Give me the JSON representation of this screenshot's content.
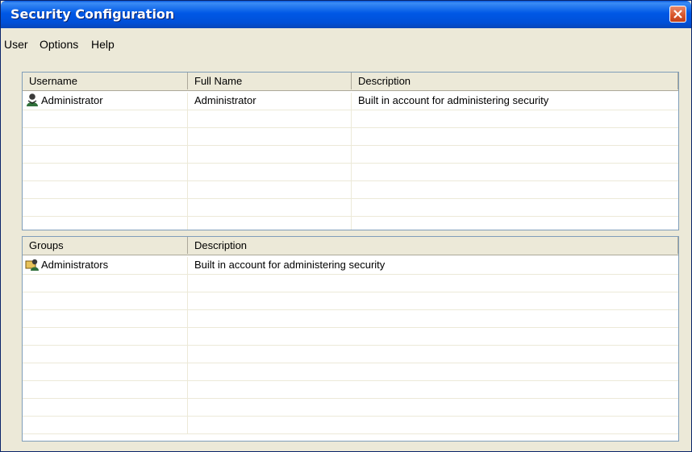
{
  "window": {
    "title": "Security Configuration"
  },
  "menu": {
    "items": [
      "User",
      "Options",
      "Help"
    ]
  },
  "users": {
    "columns": [
      "Username",
      "Full Name",
      "Description"
    ],
    "rows": [
      {
        "username": "Administrator",
        "full_name": "Administrator",
        "description": "Built in account for administering security",
        "icon": "user-icon"
      }
    ]
  },
  "groups": {
    "columns": [
      "Groups",
      "Description"
    ],
    "rows": [
      {
        "name": "Administrators",
        "description": "Built in account for administering security",
        "icon": "group-icon"
      }
    ]
  },
  "colors": {
    "titlebar": "#0058e6",
    "close": "#d8542a",
    "face": "#ece9d8"
  }
}
